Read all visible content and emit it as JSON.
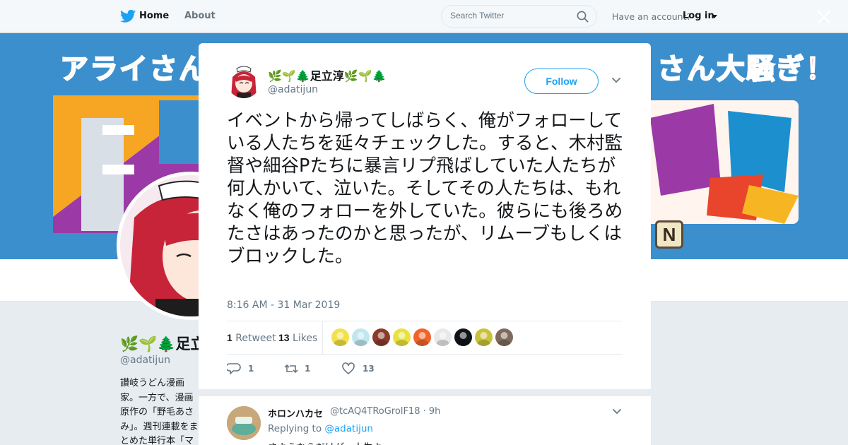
{
  "nav": {
    "home_label": "Home",
    "about_label": "About",
    "search_placeholder": "Search Twitter",
    "account_prompt": "Have an account?",
    "login_label": "Log in"
  },
  "banner": {
    "title_left": "アライさん",
    "title_right": "さん大騒ぎ！",
    "letter": "N"
  },
  "background_profile": {
    "name": "🌿🌱🌲足立淳",
    "handle": "@adatijun",
    "bio": "讃岐うどん漫画家。一方で、漫画原作の「野毛あさみ」。週刊連載をまとめた単行本「マンガ図書館Z"
  },
  "tweet": {
    "author_name": "🌿🌱🌲足立淳🌿🌱🌲",
    "author_handle": "@adatijun",
    "follow_label": "Follow",
    "text": "イベントから帰ってしばらく、俺がフォローしている人たちを延々チェックした。すると、木村監督や細谷Pたちに暴言リプ飛ばしていた人たちが何人かいて、泣いた。そしてその人たちは、もれなく俺のフォローを外していた。彼らにも後ろめたさはあったのかと思ったが、リムーブもしくはブロックした。",
    "timestamp": "8:16 AM - 31 Mar 2019",
    "retweet_count": "1",
    "retweet_label": "Retweet",
    "like_count": "13",
    "like_label": "Likes",
    "actions": {
      "reply_count": "1",
      "retweet_count": "1",
      "like_count": "13"
    },
    "likers": [
      {
        "name": "liker-avatar-1",
        "color": "#f2e14a"
      },
      {
        "name": "liker-avatar-2",
        "color": "#bfe7ef"
      },
      {
        "name": "liker-avatar-3",
        "color": "#8a3b2a"
      },
      {
        "name": "liker-avatar-4",
        "color": "#e8e33c"
      },
      {
        "name": "liker-avatar-5",
        "color": "#f0642a"
      },
      {
        "name": "liker-avatar-6",
        "color": "#e9e9e9"
      },
      {
        "name": "liker-avatar-7",
        "color": "#101418"
      },
      {
        "name": "liker-avatar-8",
        "color": "#c8c23a"
      },
      {
        "name": "liker-avatar-9",
        "color": "#7e6a5c"
      }
    ]
  },
  "reply": {
    "author_name": "ホロンハカセ",
    "author_handle": "@tcAQ4TRoGrolF18",
    "age": "9h",
    "replying_prefix": "Replying to",
    "replying_handle": "@adatijun",
    "text": "さようならだけが、人生よ。"
  },
  "colors": {
    "accent": "#1da1f2",
    "secondary_text": "#657786",
    "backdrop": "#e6ecf0"
  }
}
